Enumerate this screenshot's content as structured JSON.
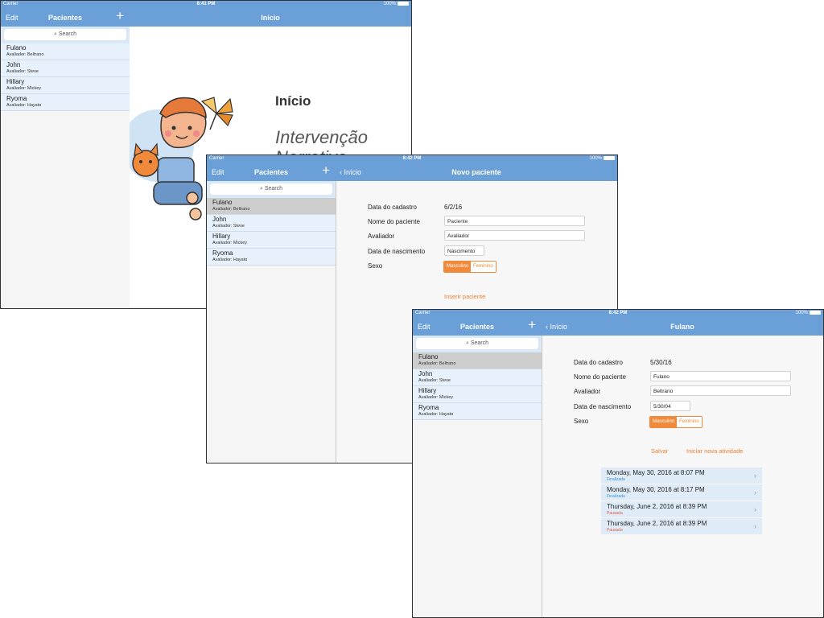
{
  "screen1": {
    "status": {
      "carrier": "Carrier",
      "time": "8:41 PM",
      "battery": "100%"
    },
    "master": {
      "edit": "Edit",
      "title": "Pacientes",
      "add": "+",
      "search": "Search",
      "patients": [
        {
          "name": "Fulano",
          "evaluator": "Avaliador: Beltrano"
        },
        {
          "name": "John",
          "evaluator": "Avaliador: Steve"
        },
        {
          "name": "Hillary",
          "evaluator": "Avaliador: Mickey"
        },
        {
          "name": "Ryoma",
          "evaluator": "Avaliador: Hayato"
        }
      ]
    },
    "detail": {
      "title": "Início",
      "heading": "Início",
      "subheading_line1": "Intervenção",
      "subheading_line2": "Narrativa"
    }
  },
  "screen2": {
    "status": {
      "carrier": "Carrier",
      "time": "8:42 PM",
      "battery": "100%"
    },
    "master": {
      "edit": "Edit",
      "title": "Pacientes",
      "add": "+",
      "search": "Search",
      "selected_index": 0,
      "patients": [
        {
          "name": "Fulano",
          "evaluator": "Avaliador: Beltrano"
        },
        {
          "name": "John",
          "evaluator": "Avaliador: Steve"
        },
        {
          "name": "Hillary",
          "evaluator": "Avaliador: Mickey"
        },
        {
          "name": "Ryoma",
          "evaluator": "Avaliador: Hayato"
        }
      ]
    },
    "detail": {
      "back": "Início",
      "title": "Novo paciente",
      "labels": {
        "date": "Data do cadastro",
        "name": "Nome do paciente",
        "evaluator": "Avaliador",
        "birth": "Data de nascimento",
        "sex": "Sexo"
      },
      "date_value": "6/2/16",
      "fields": {
        "name_placeholder": "Paciente",
        "evaluator_placeholder": "Avaliador",
        "birth_placeholder": "Nascimento"
      },
      "sex_options": {
        "male": "Masculino",
        "female": "Feminino",
        "selected": "Masculino"
      },
      "insert_button": "Inserir paciente"
    }
  },
  "screen3": {
    "status": {
      "carrier": "Carrier",
      "time": "8:42 PM",
      "battery": "100%"
    },
    "master": {
      "edit": "Edit",
      "title": "Pacientes",
      "add": "+",
      "search": "Search",
      "selected_index": 0,
      "patients": [
        {
          "name": "Fulano",
          "evaluator": "Avaliador: Beltrano"
        },
        {
          "name": "John",
          "evaluator": "Avaliador: Steve"
        },
        {
          "name": "Hillary",
          "evaluator": "Avaliador: Mickey"
        },
        {
          "name": "Ryoma",
          "evaluator": "Avaliador: Hayato"
        }
      ]
    },
    "detail": {
      "back": "Início",
      "title": "Fulano",
      "labels": {
        "date": "Data do cadastro",
        "name": "Nome do paciente",
        "evaluator": "Avaliador",
        "birth": "Data de nascimento",
        "sex": "Sexo"
      },
      "date_value": "5/30/16",
      "fields": {
        "name": "Fulano",
        "evaluator": "Beltrano",
        "birth": "5/30/04"
      },
      "sex_options": {
        "male": "Masculino",
        "female": "Feminino",
        "selected": "Masculino"
      },
      "save_button": "Salvar",
      "new_activity_button": "Iniciar nova atividade",
      "activities": [
        {
          "date": "Monday, May 30, 2016 at 8:07 PM",
          "status": "Finalizada",
          "status_color": "#3b8fd6"
        },
        {
          "date": "Monday, May 30, 2016 at 8:17 PM",
          "status": "Finalizada",
          "status_color": "#3b8fd6"
        },
        {
          "date": "Thursday, June 2, 2016 at 8:39 PM",
          "status": "Pausada",
          "status_color": "#e05a4a"
        },
        {
          "date": "Thursday, June 2, 2016 at 8:39 PM",
          "status": "Pausada",
          "status_color": "#e05a4a"
        }
      ]
    }
  },
  "colors": {
    "navbar": "#6a9fd8",
    "accent": "#f08a3a",
    "list_row": "#e6f1fb",
    "selected_row": "#cdcdcd"
  }
}
